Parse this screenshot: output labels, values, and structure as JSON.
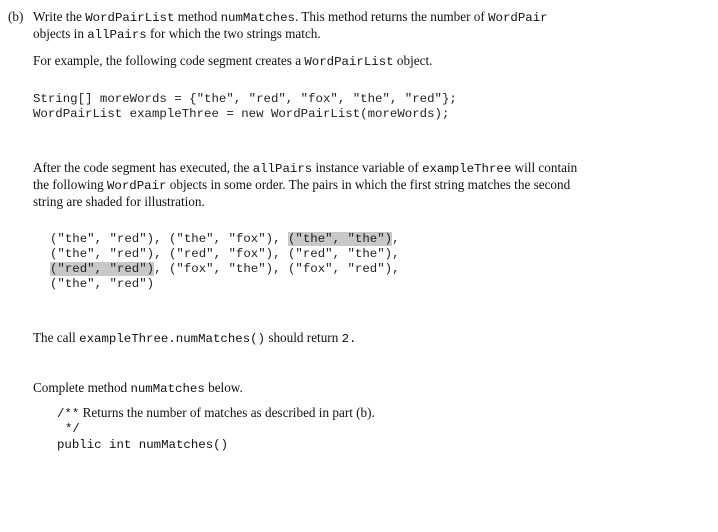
{
  "part_label": "(b)",
  "intro": {
    "line1": {
      "t1": "Write the",
      "c1": "WordPairList",
      "t2": "method",
      "c2": "numMatches",
      "t3": ". This method returns the number of",
      "c3": "WordPair"
    },
    "line2": {
      "t1": "objects in",
      "c1": "allPairs",
      "t2": "for which the two strings match."
    }
  },
  "example_intro": {
    "t1": "For example, the following code segment creates a",
    "c1": "WordPairList",
    "t2": "object."
  },
  "code_segment": [
    "String[] moreWords = {\"the\", \"red\", \"fox\", \"the\", \"red\"};",
    "WordPairList exampleThree = new WordPairList(moreWords);"
  ],
  "after_text": {
    "line1": {
      "t1": "After the code segment has executed, the",
      "c1": "allPairs",
      "t2": "instance variable of",
      "c2": "exampleThree",
      "t3": "will contain"
    },
    "line2": {
      "t1": "the following",
      "c1": "WordPair",
      "t2": "objects in some order. The pairs in which the first string matches the second"
    },
    "line3": "string are shaded for illustration."
  },
  "pairs": [
    {
      "text": "(\"the\", \"red\")",
      "shaded": false
    },
    {
      "text": "(\"the\", \"fox\")",
      "shaded": false
    },
    {
      "text": "(\"the\", \"the\")",
      "shaded": true
    },
    {
      "text": "(\"the\", \"red\")",
      "shaded": false
    },
    {
      "text": "(\"red\", \"fox\")",
      "shaded": false
    },
    {
      "text": "(\"red\", \"the\")",
      "shaded": false
    },
    {
      "text": "(\"red\", \"red\")",
      "shaded": true
    },
    {
      "text": "(\"fox\", \"the\")",
      "shaded": false
    },
    {
      "text": "(\"fox\", \"red\")",
      "shaded": false
    },
    {
      "text": "(\"the\", \"red\")",
      "shaded": false
    }
  ],
  "separator": ",",
  "call_text": {
    "t1": "The call",
    "c1": "exampleThree.numMatches()",
    "t2": "should return",
    "c2": "2."
  },
  "complete_text": {
    "t1": "Complete method",
    "c1": "numMatches",
    "t2": "below."
  },
  "method_stub": {
    "comment_open": "/**",
    "comment_text": "Returns the number of matches as described in part (b).",
    "comment_close": "*/",
    "signature": "public int numMatches()"
  },
  "colors": {
    "shade": "#c8c8c8",
    "text": "#111111"
  }
}
